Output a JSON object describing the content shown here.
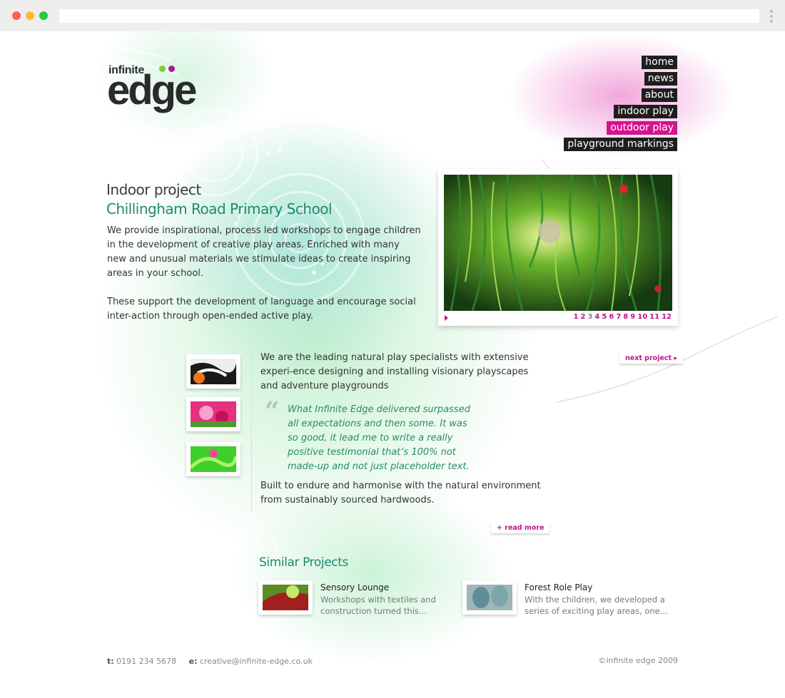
{
  "nav": {
    "home": "home",
    "news": "news",
    "about": "about",
    "indoor": "indoor play",
    "outdoor": "outdoor play",
    "markings": "playground markings"
  },
  "logo": {
    "top": "infinite",
    "main": "edge"
  },
  "project": {
    "type": "Indoor project",
    "name": "Chillingham Road Primary School",
    "intro_p1": "We provide inspirational, process led workshops to engage children in the development of creative play areas. Enriched with many new and unusual materials we stimulate ideas to create inspiring areas in your school.",
    "intro_p2": "These support the development of language and encourage social inter-action through open-ended active play."
  },
  "gallery": {
    "pages": [
      "1",
      "2",
      "3",
      "4",
      "5",
      "6",
      "7",
      "8",
      "9",
      "10",
      "11",
      "12"
    ],
    "current": "3"
  },
  "body": {
    "para1": "We are the leading natural play specialists with extensive experi-ence designing and installing visionary playscapes and adventure playgrounds",
    "quote_mark": "“",
    "quote": "What Infinite Edge delivered surpassed all expectations and then some. It was so good, it lead me to write a really positive testimonial that’s 100% not made-up and not just placeholder text.",
    "para2": "Built to endure and harmonise with the natural environment from sustainably sourced hardwoods."
  },
  "links": {
    "next_project": "next project",
    "read_more": "+ read more"
  },
  "similar": {
    "heading": "Similar Projects",
    "items": [
      {
        "title": "Sensory Lounge",
        "desc": "Workshops with textiles and construction turned this..."
      },
      {
        "title": "Forest Role Play",
        "desc": "With the children, we developed a series of exciting play areas, one..."
      }
    ]
  },
  "footer": {
    "tel_label": "t:",
    "tel": "0191 234 5678",
    "email_label": "e:",
    "email": "creative@infinite-edge.co.uk",
    "copyright": "©infinite edge 2009"
  },
  "colors": {
    "accent": "#d4148c",
    "green": "#1f8a6a",
    "nav_bg": "#1e1e1e"
  },
  "icons": [
    "browser-close-dot",
    "browser-minimize-dot",
    "browser-maximize-dot",
    "kebab-menu-icon",
    "play-icon",
    "quote-icon"
  ]
}
